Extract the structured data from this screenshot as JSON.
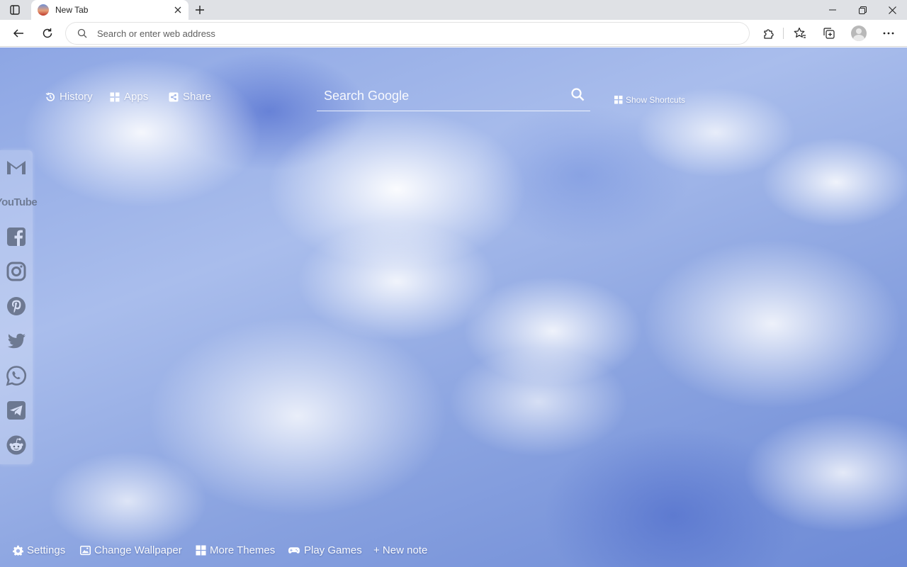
{
  "browser": {
    "tab": {
      "title": "New Tab"
    },
    "address_bar": {
      "placeholder": "Search or enter web address"
    }
  },
  "newtab": {
    "top_links": [
      {
        "label": "History",
        "icon": "history-icon"
      },
      {
        "label": "Apps",
        "icon": "apps-grid-icon"
      },
      {
        "label": "Share",
        "icon": "share-icon"
      }
    ],
    "search": {
      "placeholder": "Search Google"
    },
    "shortcuts": {
      "label": "Show Shortcuts"
    },
    "sidebar": {
      "items": [
        {
          "name": "Gmail",
          "icon": "gmail-icon"
        },
        {
          "name": "YouTube",
          "icon": "youtube-icon",
          "wordmark": "YouTube"
        },
        {
          "name": "Facebook",
          "icon": "facebook-icon"
        },
        {
          "name": "Instagram",
          "icon": "instagram-icon"
        },
        {
          "name": "Pinterest",
          "icon": "pinterest-icon"
        },
        {
          "name": "Twitter",
          "icon": "twitter-icon"
        },
        {
          "name": "WhatsApp",
          "icon": "whatsapp-icon"
        },
        {
          "name": "Telegram",
          "icon": "telegram-icon"
        },
        {
          "name": "Reddit",
          "icon": "reddit-icon"
        }
      ]
    },
    "bottom_links": [
      {
        "label": "Settings",
        "icon": "gear-icon"
      },
      {
        "label": "Change Wallpaper",
        "icon": "image-icon"
      },
      {
        "label": "More Themes",
        "icon": "grid-icon"
      },
      {
        "label": "Play Games",
        "icon": "gamepad-icon"
      },
      {
        "label": "+ New note",
        "icon": ""
      }
    ]
  },
  "colors": {
    "sky_top": "#8da6e4",
    "sky_bottom": "#6d8ad6",
    "chrome_bg": "#dfe1e5"
  }
}
